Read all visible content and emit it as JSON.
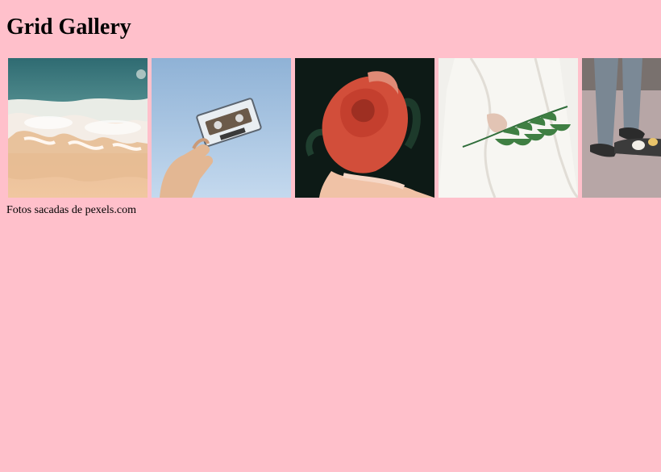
{
  "page": {
    "title": "Grid Gallery",
    "caption": "Fotos sacadas de pexels.com"
  },
  "gallery": {
    "photos": [
      {
        "name": "beach-waves-photo"
      },
      {
        "name": "cassette-tape-photo"
      },
      {
        "name": "red-rose-photo"
      },
      {
        "name": "fern-leaf-photo"
      },
      {
        "name": "skateboard-feet-photo"
      }
    ]
  },
  "colors": {
    "background": "#ffc0cb",
    "text": "#000000"
  }
}
